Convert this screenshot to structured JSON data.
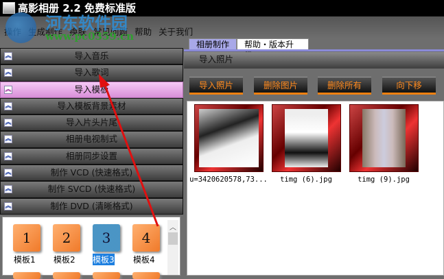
{
  "title": "高影相册 2.2 免费标准版",
  "menu": [
    "操作",
    "生成制作",
    "换肤",
    "常见问题",
    "帮助",
    "关于我们"
  ],
  "watermark": {
    "name": "河东软件园",
    "url": "www.pc0359.cn"
  },
  "nav": [
    "导入音乐",
    "导入歌词",
    "导入模板",
    "导入模板背景素材",
    "导入片头片尾",
    "相册电视制式",
    "相册同步设置",
    "制作 VCD (快速格式)",
    "制作 SVCD (快速格式)",
    "制作 DVD (清晰格式)"
  ],
  "nav_active": 2,
  "templates": [
    {
      "num": "1",
      "label": "模板1"
    },
    {
      "num": "2",
      "label": "模板2"
    },
    {
      "num": "3",
      "label": "模板3"
    },
    {
      "num": "4",
      "label": "模板4"
    }
  ],
  "tabs": [
    "相册制作",
    "帮助・版本升级"
  ],
  "section_title": "导入照片",
  "buttons": [
    "导入照片",
    "删除图片",
    "删除所有",
    "向下移"
  ],
  "photos": [
    "u=3420620578,73...",
    "timg (6).jpg",
    "timg (9).jpg"
  ]
}
